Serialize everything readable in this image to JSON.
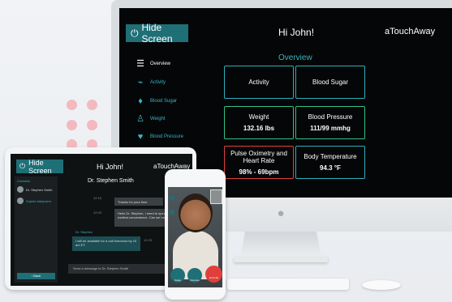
{
  "monitor": {
    "hide_screen": "Hide Screen",
    "greeting": "Hi  John!",
    "brand": "aTouchAway",
    "section_title": "Overview",
    "nav": [
      {
        "label": "Overview",
        "icon": "list-icon"
      },
      {
        "label": "Activity",
        "icon": "activity-icon"
      },
      {
        "label": "Blood Sugar",
        "icon": "drop-icon"
      },
      {
        "label": "Weight",
        "icon": "person-icon"
      },
      {
        "label": "Blood Pressure",
        "icon": "heart-icon"
      }
    ],
    "tiles": [
      {
        "title": "Activity",
        "value": ""
      },
      {
        "title": "Blood Sugar",
        "value": ""
      },
      {
        "title": "Weight",
        "value": "132.16 lbs"
      },
      {
        "title": "Blood Pressure",
        "value": "111/99 mmhg"
      },
      {
        "title": "Pulse Oximetry and Heart Rate",
        "value": "98% - 69bpm"
      },
      {
        "title": "Body Temperature",
        "value": "94.3 °F"
      }
    ]
  },
  "tablet": {
    "hide_screen": "Hide Screen",
    "greeting": "Hi  John!",
    "brand": "aTouchAway",
    "contacts_header": "Contacts",
    "contacts": [
      "Dr. Stephen Smith",
      "Sophie Adejuwmi"
    ],
    "back": "Back",
    "chat_title": "Dr. Stephen Smith",
    "messages": [
      {
        "text": "Thanks for your time",
        "time": "12:15"
      },
      {
        "text": "Hello Dr. Stephen, I need to speak to you at your earliest convenience. Can we have a video chat?",
        "time": "12:20"
      },
      {
        "sender": "Dr. Stephen",
        "text": "I will be available for a call tomorrow by 10 am ET.",
        "time": "12:25"
      }
    ],
    "input_placeholder": "Send a message to Dr. Stephen Smith"
  },
  "phone": {
    "buttons": [
      "Swap",
      "Remove",
      "End call"
    ]
  },
  "colors": {
    "teal": "#1f6f76",
    "accent": "#36b5c4",
    "green": "#2fc38a",
    "red": "#e0403b"
  }
}
